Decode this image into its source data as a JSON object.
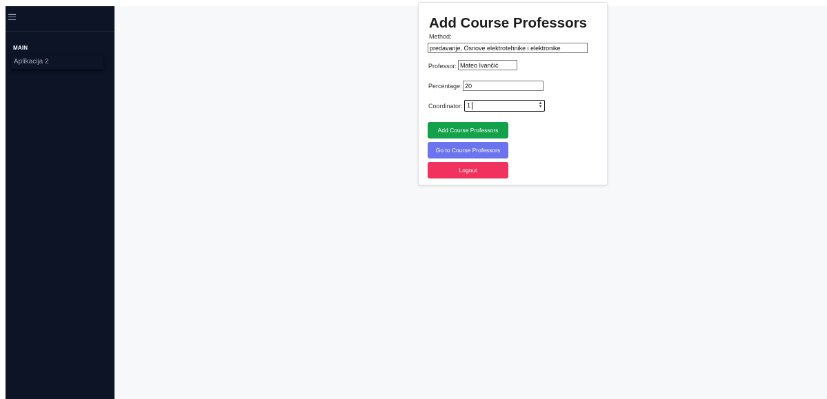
{
  "sidebar": {
    "menu_icon": "hamburger-menu-icon",
    "section_label": "MAIN",
    "items": [
      {
        "label": "Aplikacija 2"
      }
    ]
  },
  "form": {
    "title": "Add Course Professors",
    "method": {
      "label": "Method:",
      "value": "predavanje, Osnove elektrotehnike i elektronike"
    },
    "professor": {
      "label": "Professor:",
      "value": "Mateo Ivančić"
    },
    "percentage": {
      "label": "Percentage:",
      "value": "20"
    },
    "coordinator": {
      "label": "Coordinator:",
      "value": "1"
    },
    "buttons": {
      "add": "Add Course Professors",
      "go": "Go to Course Professors",
      "logout": "Logout"
    }
  },
  "colors": {
    "sidebar_bg": "#0c1426",
    "page_bg": "#f7f8fa",
    "add_button": "#14a14c",
    "go_button": "#6c73ee",
    "logout_button": "#f1325e"
  }
}
